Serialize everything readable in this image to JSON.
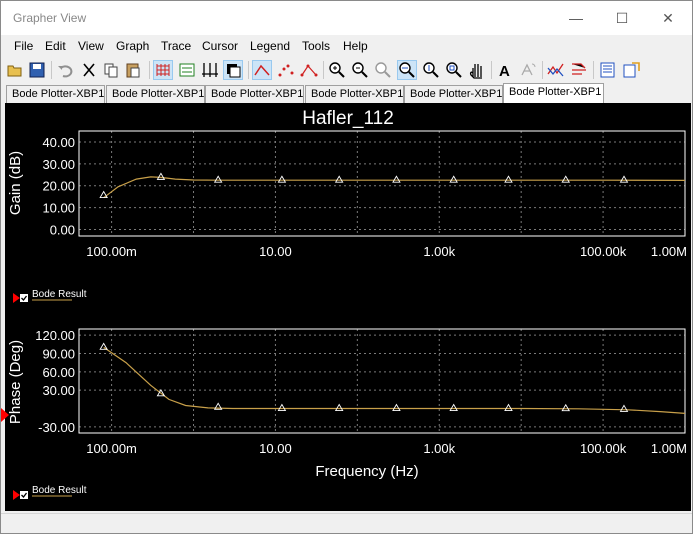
{
  "window": {
    "title": "Grapher View",
    "minimize_glyph": "—",
    "maximize_glyph": "☐",
    "close_glyph": "✕"
  },
  "menu": [
    "File",
    "Edit",
    "View",
    "Graph",
    "Trace",
    "Cursor",
    "Legend",
    "Tools",
    "Help"
  ],
  "toolbar": {
    "icons": [
      "open-icon",
      "save-icon",
      "undo-icon",
      "cut-icon",
      "copy-icon",
      "paste-icon",
      "grid-icon",
      "legend-icon",
      "toggle-cursors-icon",
      "invert-colors-icon",
      "show-lines-icon",
      "show-points-icon",
      "show-lines-points-icon",
      "zoom-in-icon",
      "zoom-out-icon",
      "zoom-full-icon",
      "zoom-x-icon",
      "zoom-y-icon",
      "zoom-box-icon",
      "pan-icon",
      "text-icon",
      "text-disabled-icon",
      "overlay-traces-icon",
      "export-icon",
      "print-icon"
    ],
    "text_tool_label": "A"
  },
  "tabs": [
    {
      "label": "Bode Plotter-XBP1",
      "active": false
    },
    {
      "label": "Bode Plotter-XBP1",
      "active": false
    },
    {
      "label": "Bode Plotter-XBP1",
      "active": false
    },
    {
      "label": "Bode Plotter-XBP1",
      "active": false
    },
    {
      "label": "Bode Plotter-XBP1",
      "active": false
    },
    {
      "label": "Bode Plotter-XBP1",
      "active": true
    }
  ],
  "colors": {
    "background": "#000000",
    "trace": "#c8a04a",
    "grid": "#7a7a7a",
    "axis": "#ffffff",
    "legend_marker": "#ff0000"
  },
  "chart_data": [
    {
      "type": "line",
      "title": "Hafler_112",
      "ylabel": "Gain (dB)",
      "xscale": "log",
      "xlim": [
        0.04,
        1000000
      ],
      "ylim": [
        -3,
        45
      ],
      "y_ticks": [
        "40.00",
        "30.00",
        "20.00",
        "10.00",
        "0.00"
      ],
      "y_tick_values": [
        40,
        30,
        20,
        10,
        0
      ],
      "x_ticks": [
        "100.00m",
        "10.00",
        "1.00k",
        "100.00k",
        "1.00M"
      ],
      "x_tick_values": [
        0.1,
        10,
        1000,
        100000,
        1000000
      ],
      "grid": true,
      "legend": {
        "label": "Bode Result",
        "checked": true,
        "position": "bottom-left"
      },
      "series": [
        {
          "name": "Bode Result",
          "x": [
            0.08,
            0.12,
            0.2,
            0.3,
            0.4,
            0.6,
            1,
            2,
            10,
            100,
            1000,
            10000,
            100000,
            1000000
          ],
          "y": [
            14.5,
            19.5,
            23.0,
            24.0,
            23.8,
            23.0,
            22.6,
            22.5,
            22.5,
            22.5,
            22.5,
            22.5,
            22.5,
            22.4
          ]
        }
      ],
      "markers": {
        "x": [
          0.08,
          0.4,
          2,
          12,
          60,
          300,
          1500,
          7000,
          35000,
          180000
        ],
        "y": [
          15.5,
          23.8,
          22.5,
          22.5,
          22.5,
          22.5,
          22.5,
          22.5,
          22.5,
          22.5
        ]
      }
    },
    {
      "type": "line",
      "xlabel": "Frequency (Hz)",
      "ylabel": "Phase (Deg)",
      "xscale": "log",
      "xlim": [
        0.04,
        1000000
      ],
      "ylim": [
        -40,
        130
      ],
      "y_ticks": [
        "120.00",
        "90.00",
        "60.00",
        "30.00",
        "-30.00"
      ],
      "y_tick_values": [
        120,
        90,
        60,
        30,
        -30
      ],
      "x_ticks": [
        "100.00m",
        "10.00",
        "1.00k",
        "100.00k",
        "1.00M"
      ],
      "x_tick_values": [
        0.1,
        10,
        1000,
        100000,
        1000000
      ],
      "grid": true,
      "legend": {
        "label": "Bode Result",
        "checked": true,
        "position": "bottom-left"
      },
      "series": [
        {
          "name": "Bode Result",
          "x": [
            0.08,
            0.15,
            0.3,
            0.5,
            0.8,
            1.5,
            3,
            10,
            100,
            1000,
            10000,
            50000,
            200000,
            500000,
            1000000
          ],
          "y": [
            100,
            75,
            38,
            15,
            5,
            1,
            0,
            0,
            0,
            0,
            0,
            -0.5,
            -2,
            -5,
            -8
          ]
        }
      ],
      "markers": {
        "x": [
          0.08,
          0.4,
          2,
          12,
          60,
          300,
          1500,
          7000,
          35000,
          180000
        ],
        "y": [
          100,
          24,
          2,
          0,
          0,
          0,
          0,
          0,
          -0.3,
          -1.5
        ]
      }
    }
  ]
}
